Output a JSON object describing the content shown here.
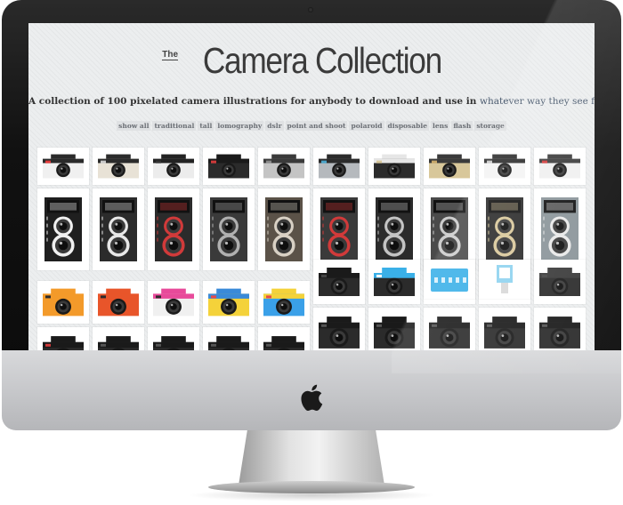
{
  "page": {
    "title_prefix": "The",
    "title": "Camera Collection",
    "tagline_main": "A collection of 100 pixelated camera illustrations for anybody to download and use in",
    "tagline_accent": "whatever way they see fit."
  },
  "filters": [
    "show all",
    "traditional",
    "tall",
    "lomography",
    "dslr",
    "point and shoot",
    "polaroid",
    "disposable",
    "lens",
    "flash",
    "storage"
  ],
  "colors": {
    "screen_bg": "#eceeef",
    "filter_bg": "#dfe1e3",
    "filter_text": "#6b6f75",
    "title": "#3b3b3b",
    "accent_text": "#4a5a6e"
  },
  "gallery": {
    "row1": [
      {
        "icon": "classic-camera-icon",
        "body": "#f0f0f0",
        "top": "#2a2a2a",
        "accent": "#e03a3a"
      },
      {
        "icon": "rangefinder-camera-icon",
        "body": "#e8e2d6",
        "top": "#2b2b2b",
        "accent": "#c8c8c8"
      },
      {
        "icon": "slr-camera-icon",
        "body": "#ececec",
        "top": "#222222",
        "accent": "#333333"
      },
      {
        "icon": "textured-camera-icon",
        "body": "#2b2b2b",
        "top": "#1a1a1a",
        "accent": "#d13a3a"
      },
      {
        "icon": "film-camera-icon",
        "body": "#c4c4c4",
        "top": "#3a3a3a",
        "accent": "#8a8a8a"
      },
      {
        "icon": "compact-camera-icon",
        "body": "#b5b9bd",
        "top": "#2b2b2b",
        "accent": "#4aa3c8"
      },
      {
        "icon": "small-camera-icon",
        "body": "#2b2b2b",
        "top": "#e6e6e6",
        "accent": "#d8c79a"
      },
      {
        "icon": "vintage-camera-icon",
        "body": "#d8c79a",
        "top": "#3a3a3a",
        "accent": "#c8a86a"
      },
      {
        "icon": "retro-camera-icon",
        "body": "#f4f4f4",
        "top": "#2b2b2b",
        "accent": "#c8c8c8"
      },
      {
        "icon": "red-lens-camera-icon",
        "body": "#f0f0f0",
        "top": "#3a3a3a",
        "accent": "#d13a3a"
      }
    ],
    "tall_row": [
      {
        "icon": "twin-lens-camera-icon",
        "body": "#1f1f1f",
        "accent": "#f0f0f0"
      },
      {
        "icon": "twin-lens-camera-icon",
        "body": "#2b2b2b",
        "accent": "#e8e8e8"
      },
      {
        "icon": "box-camera-icon",
        "body": "#2b2b2b",
        "accent": "#d13a3a"
      },
      {
        "icon": "box-camera-icon",
        "body": "#3a3a3a",
        "accent": "#b0b0b0"
      },
      {
        "icon": "twin-lens-camera-icon",
        "body": "#5b5248",
        "accent": "#d8d0c4"
      },
      {
        "icon": "twin-lens-camera-icon",
        "body": "#3a3a3a",
        "accent": "#d13a3a"
      },
      {
        "icon": "tall-camera-icon",
        "body": "#2b2b2b",
        "accent": "#c4c4c4"
      },
      {
        "icon": "twin-lens-camera-icon",
        "body": "#4a4a4a",
        "accent": "#cccccc"
      },
      {
        "icon": "box-camera-icon",
        "body": "#2b2b2b",
        "accent": "#d8c79a"
      },
      {
        "icon": "folding-camera-icon",
        "body": "#8a9499",
        "accent": "#e8e8e8"
      }
    ],
    "row3": [
      {
        "icon": "toy-camera-icon",
        "body": "#f39a2a",
        "top": "#f39a2a",
        "accent": "#2b2b2b"
      },
      {
        "icon": "toy-camera-icon",
        "body": "#e8552a",
        "top": "#e8552a",
        "accent": "#2b2b2b"
      },
      {
        "icon": "lomo-camera-icon",
        "body": "#f0f0f0",
        "top": "#e84a9a",
        "accent": "#2b2b2b"
      },
      {
        "icon": "lomo-camera-icon",
        "body": "#f4d23a",
        "top": "#3a8ad8",
        "accent": "#e84a4a"
      },
      {
        "icon": "lomo-camera-icon",
        "body": "#3aa0e8",
        "top": "#f4d23a",
        "accent": "#e84a4a"
      },
      {
        "icon": "dslr-camera-icon",
        "body": "#2b2b2b",
        "top": "#1a1a1a",
        "accent": "#444444"
      },
      {
        "icon": "instant-camera-icon",
        "body": "#2b2b2b",
        "top": "#3ab0e8",
        "accent": "#ffffff"
      },
      {
        "icon": "dslr-camera-icon",
        "body": "#2b2b2b",
        "top": "#1a1a1a",
        "accent": "#555555"
      },
      {
        "icon": "flash-camera-icon",
        "body": "#2b2b2b",
        "top": "#3ab0e8",
        "accent": "#ffffff"
      },
      {
        "icon": "point-and-shoot-icon",
        "body": "#2b2b2b",
        "top": "#3a3a3a",
        "accent": "#444444"
      }
    ],
    "row4": [
      {
        "icon": "dslr-camera-icon",
        "body": "#2b2b2b",
        "top": "#1a1a1a",
        "accent": "#d13a3a"
      },
      {
        "icon": "dslr-camera-icon",
        "body": "#2b2b2b",
        "top": "#1a1a1a",
        "accent": "#555555"
      },
      {
        "icon": "dslr-camera-icon",
        "body": "#2b2b2b",
        "top": "#1a1a1a",
        "accent": "#555555"
      },
      {
        "icon": "dslr-camera-icon",
        "body": "#2b2b2b",
        "top": "#1a1a1a",
        "accent": "#555555"
      },
      {
        "icon": "dslr-camera-icon",
        "body": "#2b2b2b",
        "top": "#1a1a1a",
        "accent": "#555555"
      },
      {
        "icon": "dslr-camera-icon",
        "body": "#2b2b2b",
        "top": "#1a1a1a",
        "accent": "#555555"
      },
      {
        "icon": "dslr-camera-icon",
        "body": "#2b2b2b",
        "top": "#1a1a1a",
        "accent": "#555555"
      },
      {
        "icon": "dslr-camera-icon",
        "body": "#2b2b2b",
        "top": "#1a1a1a",
        "accent": "#555555"
      },
      {
        "icon": "dslr-camera-icon",
        "body": "#2b2b2b",
        "top": "#1a1a1a",
        "accent": "#555555"
      },
      {
        "icon": "dslr-camera-icon",
        "body": "#2b2b2b",
        "top": "#1a1a1a",
        "accent": "#555555"
      }
    ],
    "storage_box": {
      "icon": "storage-box-icon",
      "body": "#3ab0e8"
    },
    "flash_unit": {
      "icon": "flash-unit-icon",
      "body": "#8fd3f0"
    }
  }
}
